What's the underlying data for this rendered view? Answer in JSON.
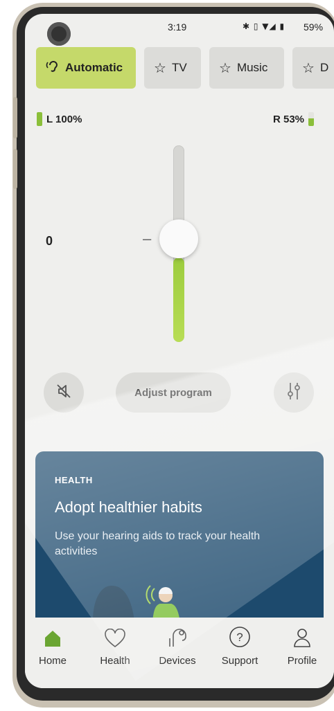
{
  "status_bar": {
    "time": "3:19",
    "icons": "✱ ▯ ▼◢ ▮",
    "battery": "59%"
  },
  "program_tabs": [
    {
      "label": "Automatic",
      "icon": "ear-icon",
      "active": true
    },
    {
      "label": "TV",
      "icon": "star-icon",
      "active": false
    },
    {
      "label": "Music",
      "icon": "star-icon",
      "active": false
    },
    {
      "label": "D",
      "icon": "star-icon",
      "active": false
    }
  ],
  "battery_left": {
    "label": "L 100%",
    "level": 1.0
  },
  "battery_right": {
    "label": "R 53%",
    "level": 0.53
  },
  "volume": {
    "value": "0",
    "minus_glyph": "–",
    "fill_level": 0.43
  },
  "controls": {
    "mute_icon": "speaker-muted-icon",
    "adjust_label": "Adjust program",
    "equalizer_icon": "sliders-icon"
  },
  "card": {
    "label": "HEALTH",
    "title": "Adopt healthier habits",
    "body": "Use your hearing aids to track your health activities"
  },
  "nav": [
    {
      "label": "Home",
      "icon": "home-icon",
      "active": true
    },
    {
      "label": "Health",
      "icon": "heart-icon",
      "active": false
    },
    {
      "label": "Devices",
      "icon": "hearing-aid-icon",
      "active": false
    },
    {
      "label": "Support",
      "icon": "question-icon",
      "active": false
    },
    {
      "label": "Profile",
      "icon": "person-icon",
      "active": false
    }
  ],
  "colors": {
    "accent": "#c5d96a",
    "card": "#1d4a6d",
    "home_active": "#6aa532"
  }
}
